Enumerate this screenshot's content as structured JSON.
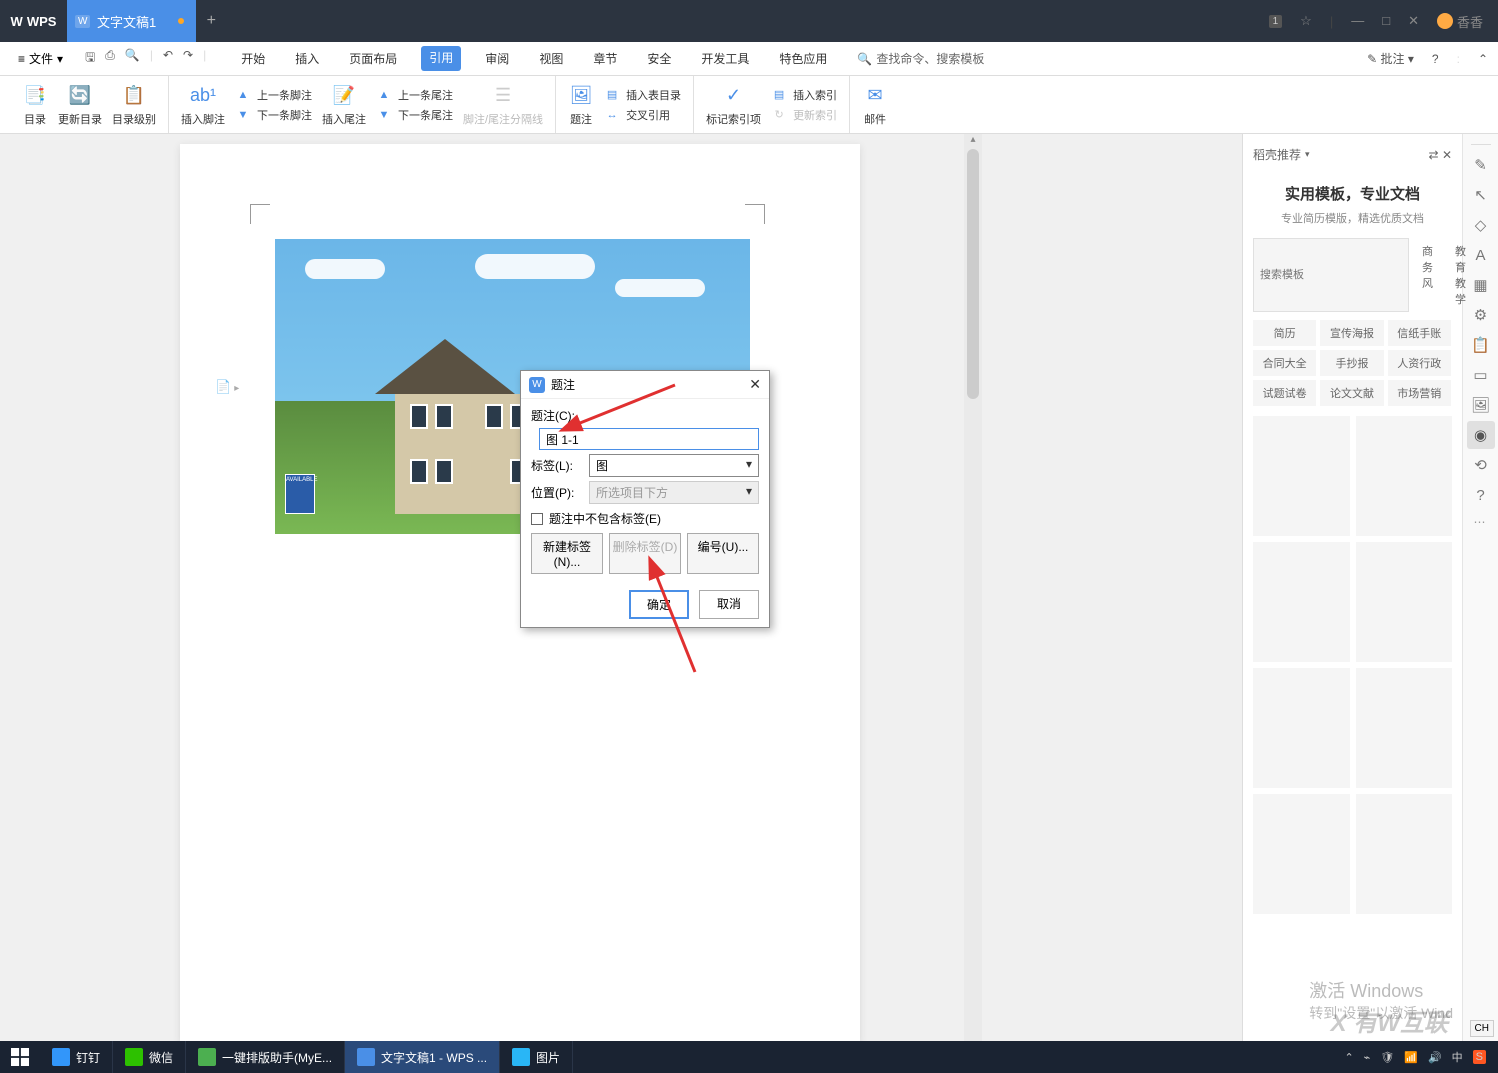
{
  "titlebar": {
    "app": "WPS",
    "doc_tab": "文字文稿1",
    "user": "香香",
    "badge": "1"
  },
  "menubar": {
    "file": "文件",
    "tabs": [
      "开始",
      "插入",
      "页面布局",
      "引用",
      "审阅",
      "视图",
      "章节",
      "安全",
      "开发工具",
      "特色应用"
    ],
    "active_idx": 3,
    "search_cmd": "查找命令、搜索模板",
    "annotate": "批注"
  },
  "ribbon": {
    "toc": "目录",
    "update_toc": "更新目录",
    "toc_level": "目录级别",
    "insert_footnote": "插入脚注",
    "prev_footnote": "上一条脚注",
    "next_footnote": "下一条脚注",
    "insert_endnote": "插入尾注",
    "prev_endnote": "上一条尾注",
    "next_endnote": "下一条尾注",
    "sep_line": "脚注/尾注分隔线",
    "caption": "题注",
    "insert_tof": "插入表目录",
    "cross_ref": "交叉引用",
    "mark_index": "标记索引项",
    "insert_index": "插入索引",
    "update_index": "更新索引",
    "mail": "邮件"
  },
  "dialog": {
    "title": "题注",
    "caption_label": "题注(C):",
    "caption_value": "图 1-1",
    "label_label": "标签(L):",
    "label_value": "图",
    "position_label": "位置(P):",
    "position_value": "所选项目下方",
    "exclude": "题注中不包含标签(E)",
    "new_label": "新建标签(N)...",
    "del_label": "删除标签(D)",
    "numbering": "编号(U)...",
    "ok": "确定",
    "cancel": "取消"
  },
  "sidepanel": {
    "header": "稻壳推荐",
    "headline": "实用模板，专业文档",
    "sub": "专业简历模版，精选优质文档",
    "search_ph": "搜索模板",
    "filters": [
      "商务风",
      "教育教学"
    ],
    "cats": [
      "简历",
      "宣传海报",
      "信纸手账",
      "合同大全",
      "手抄报",
      "人资行政",
      "试题试卷",
      "论文文献",
      "市场营销"
    ]
  },
  "watermark": {
    "line1": "激活 Windows",
    "line2": "转到\"设置\"以激活 Wind"
  },
  "taskbar": {
    "items": [
      "钉钉",
      "微信",
      "一键排版助手(MyE...",
      "文字文稿1 - WPS ...",
      "图片"
    ]
  },
  "lang": "CH"
}
